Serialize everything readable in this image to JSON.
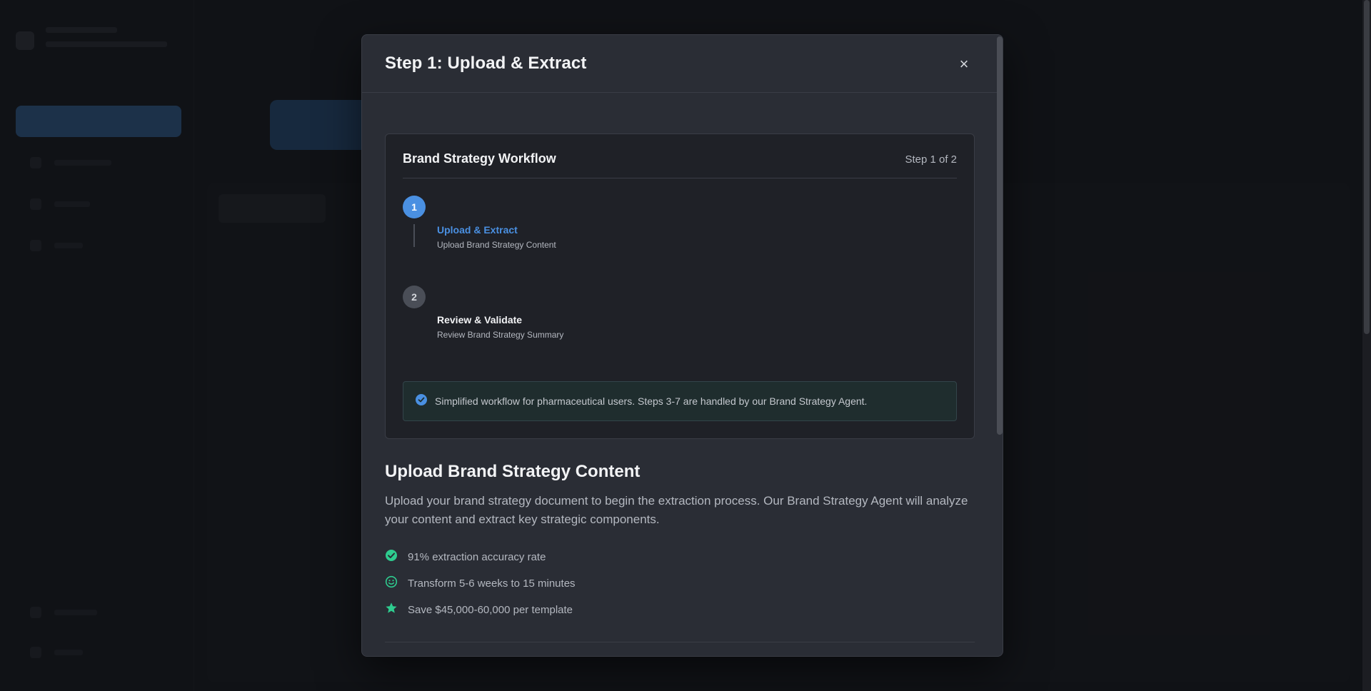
{
  "modal": {
    "title": "Step 1: Upload & Extract",
    "close_label": "×"
  },
  "workflow": {
    "title": "Brand Strategy Workflow",
    "counter": "Step 1 of 2",
    "steps": [
      {
        "number": "1",
        "title": "Upload & Extract",
        "subtitle": "Upload Brand Strategy Content",
        "state": "active"
      },
      {
        "number": "2",
        "title": "Review & Validate",
        "subtitle": "Review Brand Strategy Summary",
        "state": "pending"
      }
    ],
    "info": "Simplified workflow for pharmaceutical users. Steps 3-7 are handled by our Brand Strategy Agent."
  },
  "upload": {
    "title": "Upload Brand Strategy Content",
    "description": "Upload your brand strategy document to begin the extraction process. Our Brand Strategy Agent will analyze your content and extract key strategic components.",
    "benefits": [
      {
        "icon": "check-circle-icon",
        "text": "91% extraction accuracy rate"
      },
      {
        "icon": "smile-icon",
        "text": "Transform 5-6 weeks to 15 minutes"
      },
      {
        "icon": "star-icon",
        "text": "Save $45,000-60,000 per template"
      }
    ]
  },
  "colors": {
    "accent": "#4a90e2",
    "success": "#2ecc8f",
    "modal_bg": "#2a2d35",
    "card_bg": "#1f2127"
  }
}
